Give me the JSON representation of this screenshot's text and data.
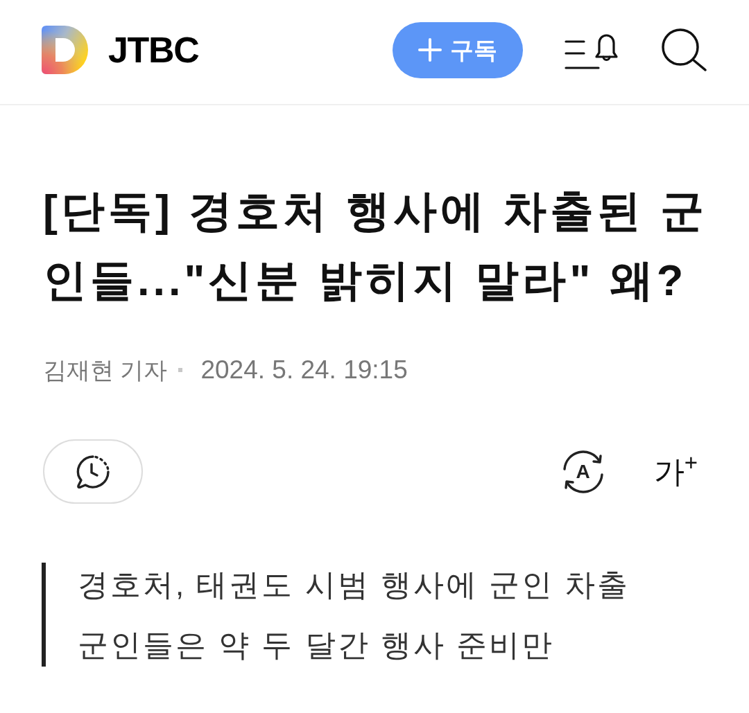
{
  "header": {
    "publisher": "JTBC",
    "subscribe_button": {
      "label": "구독"
    }
  },
  "article": {
    "title": "[단독] 경호처 행사에 차출된 군인들...\"신분 밝히지 말라\" 왜?",
    "reporter": "김재현 기자",
    "date": "2024. 5. 24. 19:15"
  },
  "toolbar": {
    "translate_button": {
      "label": "A"
    },
    "font_size_button": {
      "label": "가$^{+}$"
    }
  },
  "summary": [
    "경호처, 태권도 시범 행사에 군인 차출",
    "군인들은 약 두 달간 행사 준비만"
  ]
}
